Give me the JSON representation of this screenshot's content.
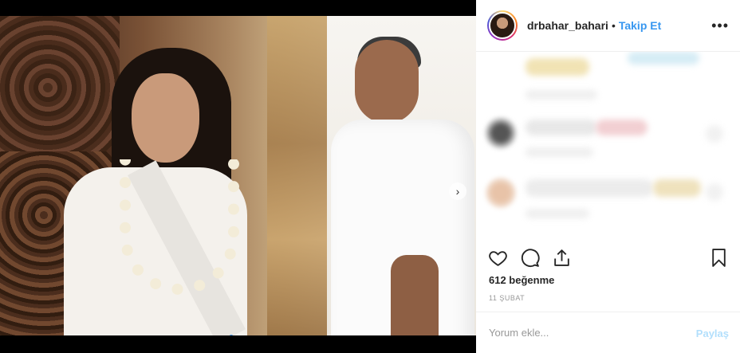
{
  "post": {
    "username": "drbahar_bahari",
    "separator": "•",
    "follow_label": "Takip Et",
    "more_label": "•••",
    "likes_text": "612 beğenme",
    "date_text": "11 ŞUBAT",
    "comment_placeholder": "Yorum ekle...",
    "share_label": "Paylaş",
    "carousel": {
      "slide_count": 2,
      "current_slide": 1
    }
  },
  "icons": {
    "like": "heart-icon",
    "comment": "comment-bubble-icon",
    "share": "share-upload-icon",
    "save": "bookmark-icon",
    "next": "chevron-right-icon"
  },
  "colors": {
    "follow_accent": "#3897f0",
    "share_disabled": "#b2dffc",
    "text_primary": "#262626",
    "text_muted": "#999999"
  }
}
